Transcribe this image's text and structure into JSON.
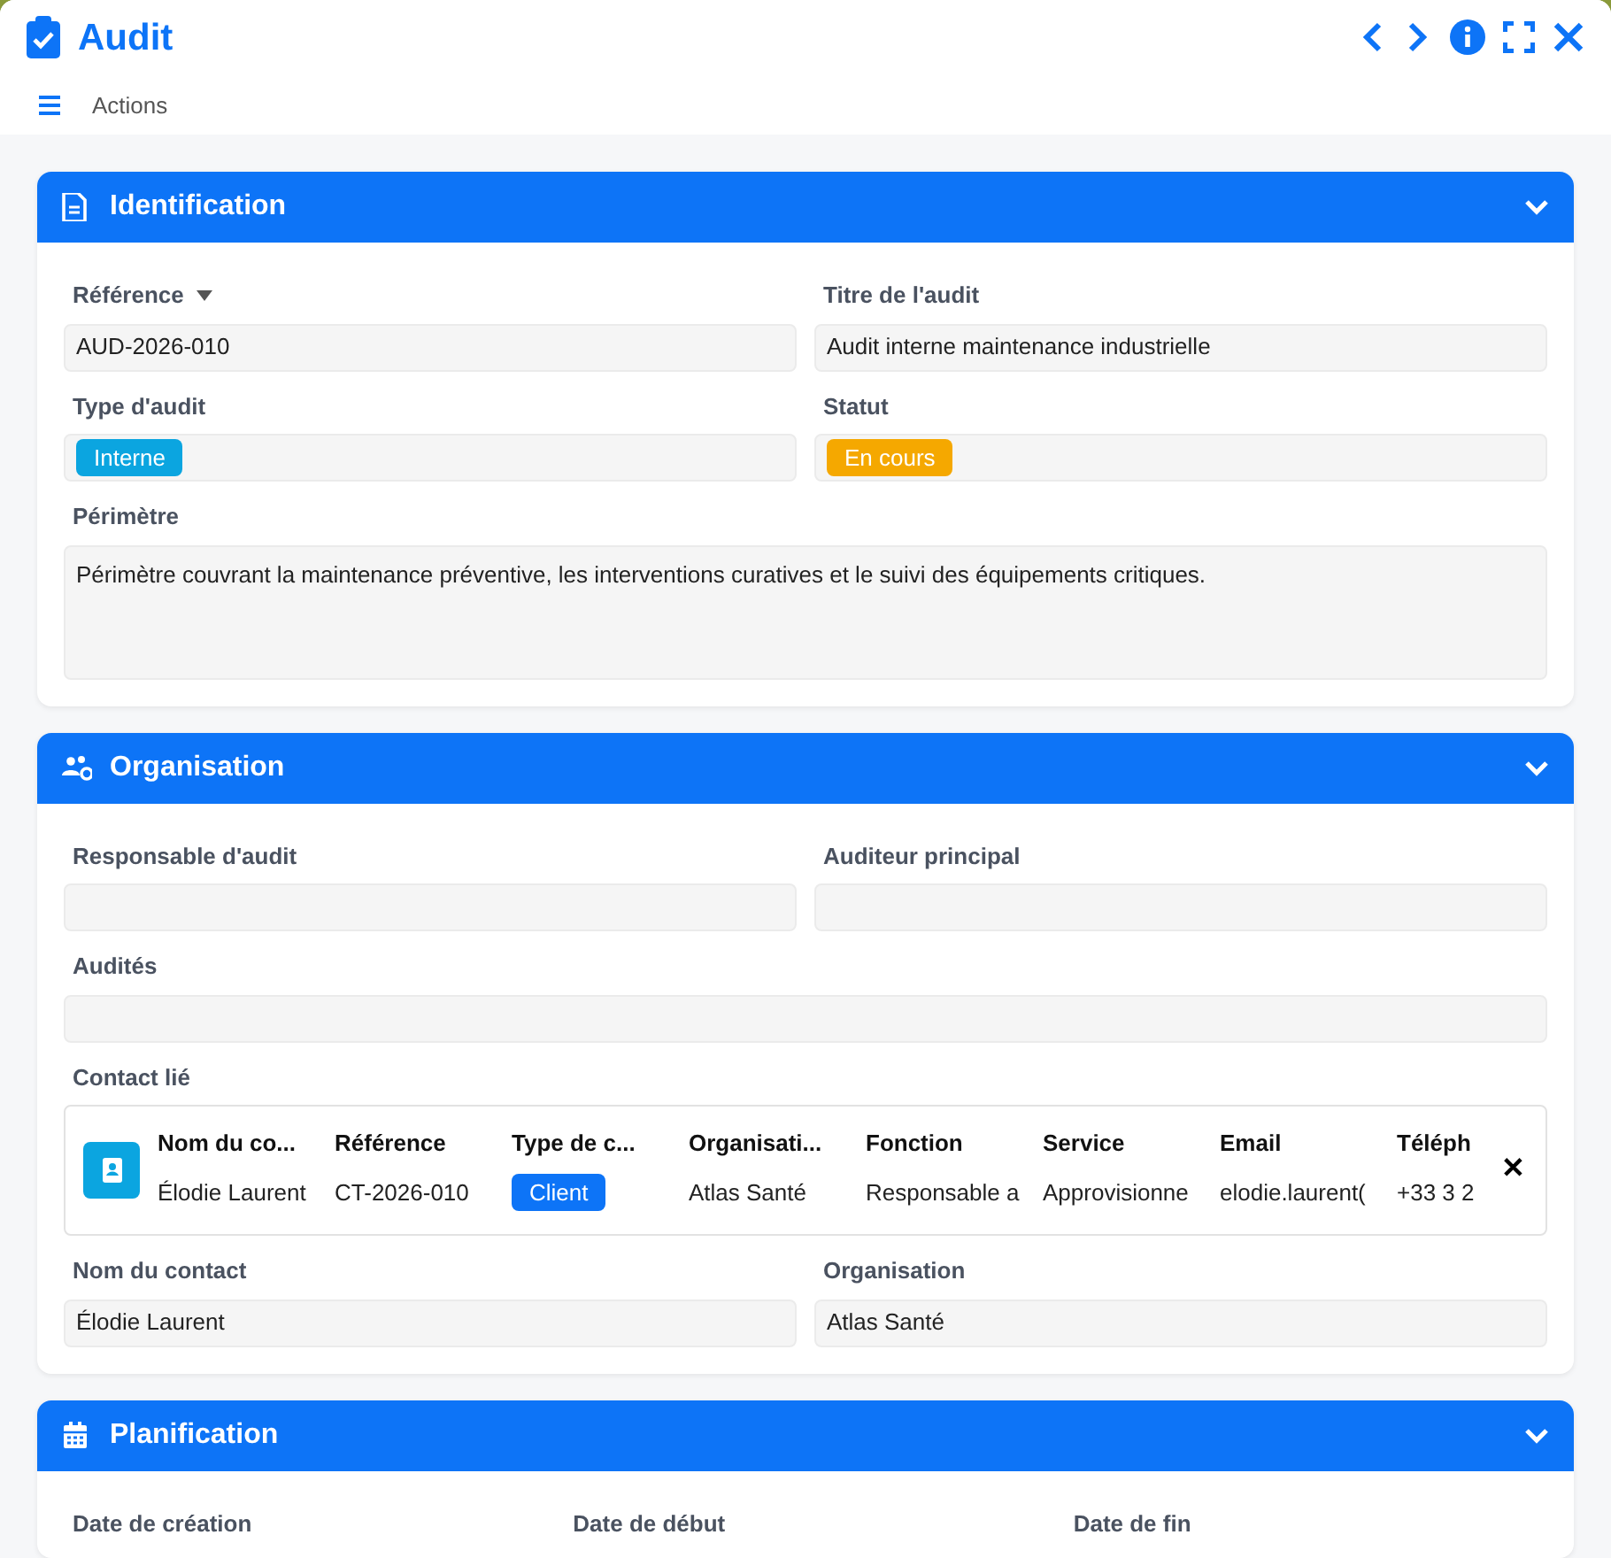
{
  "window": {
    "title": "Audit"
  },
  "toolbar": {
    "menu_label": "Actions"
  },
  "sections": [
    {
      "title": "Identification",
      "expanded": true,
      "fields": [
        {
          "label": "Référence",
          "dropdown": true,
          "kind": "text",
          "value": "AUD-2026-010"
        },
        {
          "label": "Titre de l'audit",
          "kind": "text",
          "value": "Audit interne maintenance industrielle"
        },
        {
          "label": "Type d'audit",
          "kind": "tag",
          "value": "Interne",
          "color": "#0ba5e0"
        },
        {
          "label": "Statut",
          "kind": "tag",
          "value": "En cours",
          "color": "#f5a800"
        },
        {
          "label": "Périmètre",
          "kind": "textarea",
          "value": "Périmètre couvrant la maintenance préventive, les interventions curatives et le suivi des équipements critiques."
        }
      ]
    },
    {
      "title": "Organisation",
      "expanded": true,
      "fields": [
        {
          "label": "Responsable d'audit",
          "kind": "text"
        },
        {
          "label": "Auditeur principal",
          "kind": "text"
        },
        {
          "label": "Audités",
          "kind": "wide-text"
        },
        {
          "label": "Contact lié",
          "kind": "linked-record",
          "columns": [
            "Nom du co...",
            "Référence",
            "Type de c...",
            "Organisati...",
            "Fonction",
            "Service",
            "Email",
            "Téléph"
          ],
          "row": [
            {
              "kind": "text",
              "value": "Élodie Laurent"
            },
            {
              "kind": "text",
              "value": "CT-2026-010"
            },
            {
              "kind": "tag",
              "value": "Client",
              "color": "#0d74f7"
            },
            {
              "kind": "text",
              "value": "Atlas Santé"
            },
            {
              "kind": "text",
              "value": "Responsable a"
            },
            {
              "kind": "text",
              "value": "Approvisionne"
            },
            {
              "kind": "text",
              "value": "elodie.laurent("
            },
            {
              "kind": "text",
              "value": "+33 3 2"
            }
          ],
          "remove_label": "✕"
        },
        {
          "label": "Nom du contact",
          "kind": "text",
          "value": "Élodie Laurent"
        },
        {
          "label": "Organisation",
          "kind": "text",
          "value": "Atlas Santé"
        }
      ]
    },
    {
      "title": "Planification",
      "expanded": true,
      "fields": [
        {
          "label": "Date de création",
          "kind": "label-only"
        },
        {
          "label": "Date de début",
          "kind": "label-only"
        },
        {
          "label": "Date de fin",
          "kind": "label-only"
        }
      ]
    }
  ]
}
